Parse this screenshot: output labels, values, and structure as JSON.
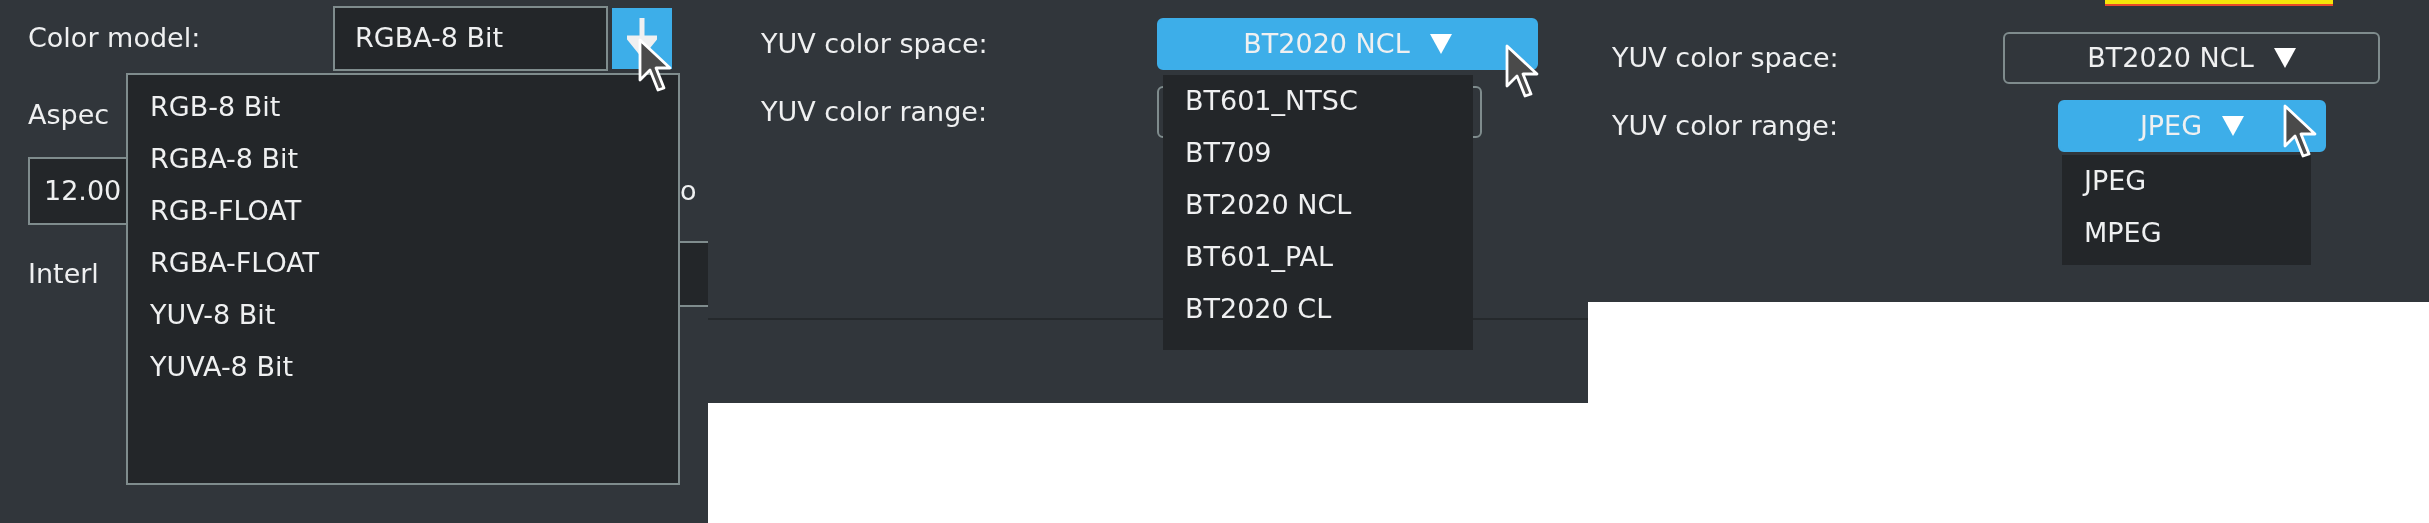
{
  "screens": [
    {
      "kind": "color-model",
      "label": "Color model:",
      "value": "RGBA-8 Bit",
      "open": true,
      "aspect_label": "Aspec",
      "aspect_value": "12.00",
      "aspect_tail": "o",
      "interlace_label": "Interl",
      "options": [
        {
          "label": "RGB-8 Bit"
        },
        {
          "label": "RGBA-8 Bit"
        },
        {
          "label": "RGB-FLOAT"
        },
        {
          "label": "RGBA-FLOAT"
        },
        {
          "label": "YUV-8 Bit"
        },
        {
          "label": "YUVA-8 Bit"
        }
      ]
    },
    {
      "kind": "yuv",
      "highlight": false,
      "rows": [
        {
          "label": "YUV color space:",
          "value": "BT2020 NCL",
          "open": true
        },
        {
          "label": "YUV color range:",
          "open": false
        }
      ],
      "options": [
        {
          "label": "BT601_NTSC"
        },
        {
          "label": "BT709"
        },
        {
          "label": "BT2020 NCL"
        },
        {
          "label": "BT601_PAL"
        },
        {
          "label": "BT2020 CL"
        }
      ]
    },
    {
      "kind": "yuv",
      "highlight": true,
      "rows": [
        {
          "label": "YUV color space:",
          "value": "BT2020 NCL",
          "open": false
        },
        {
          "label": "YUV color range:",
          "value": "JPEG",
          "open": true
        }
      ],
      "options": [
        {
          "label": "JPEG"
        },
        {
          "label": "MPEG"
        }
      ]
    }
  ]
}
